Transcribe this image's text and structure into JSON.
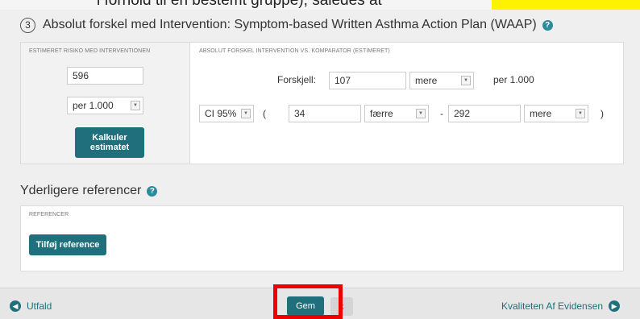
{
  "top_strip": {
    "text": "i forhold til en bestemt gruppe), således at"
  },
  "section": {
    "number": "3",
    "title": "Absolut forskel med Intervention: Symptom-based Written Asthma Action Plan (WAAP)",
    "help": "?"
  },
  "estimate": {
    "label": "ESTIMERET RISIKO MED INTERVENTIONEN",
    "value": "596",
    "unit": "per 1.000",
    "calc_button": "Kalkuler estimatet"
  },
  "difference": {
    "label": "ABSOLUT FORSKEL INTERVENTION VS. KOMPARATOR (ESTIMERET)",
    "forskjell_label": "Forskjell:",
    "value": "107",
    "direction": "mere",
    "per": "per 1.000",
    "ci_select": "CI 95%",
    "paren_open": "(",
    "low": "34",
    "low_dir": "færre",
    "dash": "-",
    "high": "292",
    "high_dir": "mere",
    "paren_close": ")"
  },
  "references": {
    "title": "Yderligere referencer",
    "help": "?",
    "label": "REFERENCER",
    "add_button": "Tilføj reference"
  },
  "footer": {
    "prev": "Utfald",
    "save": "Gem",
    "next_cut": "k",
    "next": "Kvaliteten Af Evidensen"
  },
  "colors": {
    "accent": "#1f6f7c",
    "highlight": "#ff0000",
    "marker": "#fff200"
  }
}
